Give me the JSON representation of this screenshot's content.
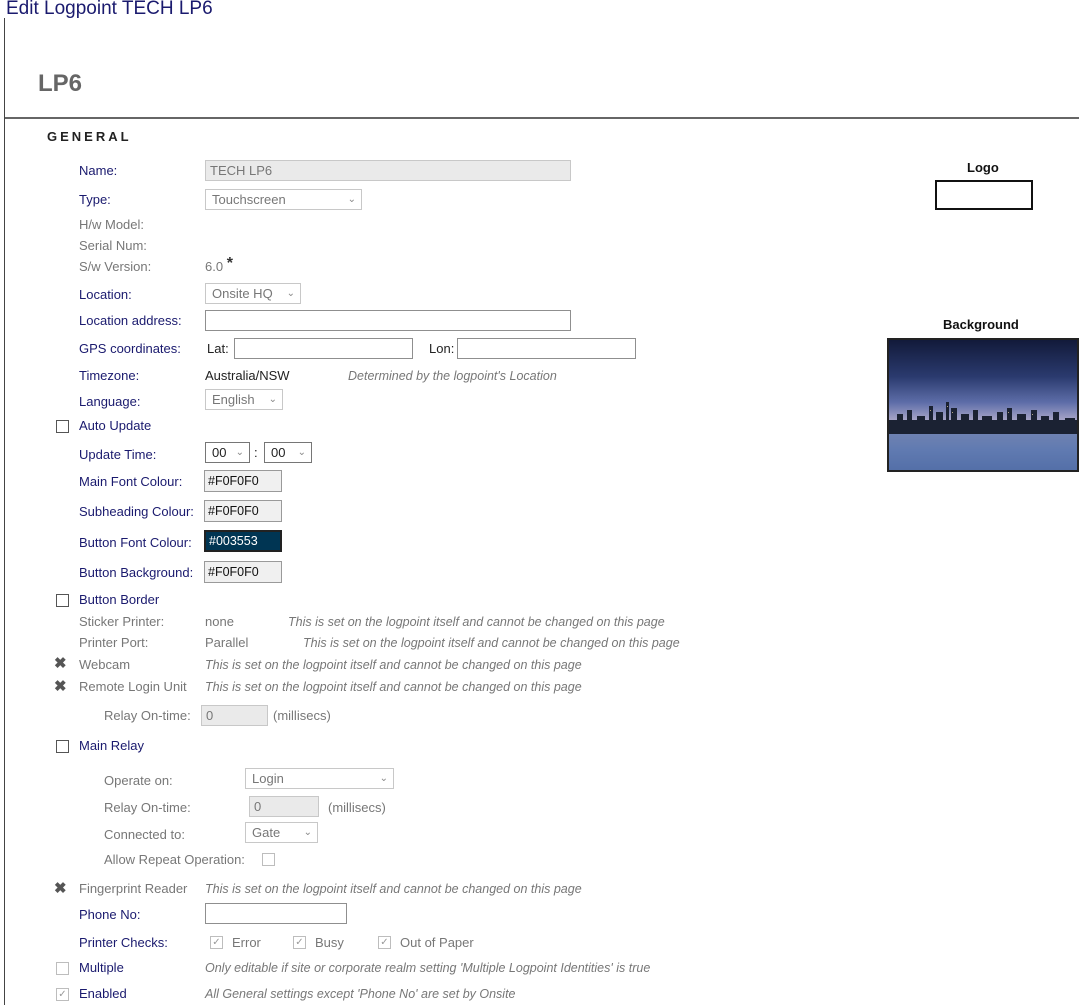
{
  "window": {
    "title": "Edit Logpoint TECH LP6"
  },
  "page": {
    "heading": "LP6",
    "section_title": "GENERAL"
  },
  "form": {
    "name": {
      "label": "Name:",
      "value": "TECH LP6"
    },
    "type": {
      "label": "Type:",
      "value": "Touchscreen"
    },
    "hw_model": {
      "label": "H/w Model:"
    },
    "serial_num": {
      "label": "Serial Num:"
    },
    "sw_version": {
      "label": "S/w Version:",
      "value": "6.0",
      "marker": "*"
    },
    "location": {
      "label": "Location:",
      "value": "Onsite HQ"
    },
    "location_address": {
      "label": "Location address:",
      "value": ""
    },
    "gps": {
      "label": "GPS coordinates:",
      "lat_label": "Lat:",
      "lat_value": "",
      "lon_label": "Lon:",
      "lon_value": ""
    },
    "timezone": {
      "label": "Timezone:",
      "value": "Australia/NSW",
      "note": "Determined by the logpoint's Location"
    },
    "language": {
      "label": "Language:",
      "value": "English"
    },
    "auto_update": {
      "label": "Auto Update",
      "checked": false
    },
    "update_time": {
      "label": "Update Time:",
      "hour": "00",
      "minute": "00",
      "separator": ":"
    },
    "main_font_colour": {
      "label": "Main Font Colour:",
      "value": "#F0F0F0"
    },
    "subheading_colour": {
      "label": "Subheading Colour:",
      "value": "#F0F0F0"
    },
    "button_font_colour": {
      "label": "Button Font Colour:",
      "value": "#003553"
    },
    "button_background": {
      "label": "Button Background:",
      "value": "#F0F0F0"
    },
    "button_border": {
      "label": "Button Border",
      "checked": false
    },
    "sticker_printer": {
      "label": "Sticker Printer:",
      "value": "none",
      "note": "This is set on the logpoint itself and cannot be changed on this page"
    },
    "printer_port": {
      "label": "Printer Port:",
      "value": "Parallel",
      "note": "This is set on the logpoint itself and cannot be changed on this page"
    },
    "webcam": {
      "label": "Webcam",
      "icon": "x-icon",
      "note": "This is set on the logpoint itself and cannot be changed on this page"
    },
    "remote_login_unit": {
      "label": "Remote Login Unit",
      "icon": "x-icon",
      "note": "This is set on the logpoint itself and cannot be changed on this page"
    },
    "relay_on_time_1": {
      "label": "Relay On-time:",
      "value": "0",
      "unit": "(millisecs)"
    },
    "main_relay": {
      "label": "Main Relay",
      "checked": false
    },
    "operate_on": {
      "label": "Operate on:",
      "value": "Login"
    },
    "relay_on_time_2": {
      "label": "Relay On-time:",
      "value": "0",
      "unit": "(millisecs)"
    },
    "connected_to": {
      "label": "Connected to:",
      "value": "Gate"
    },
    "allow_repeat": {
      "label": "Allow Repeat Operation:",
      "checked": false
    },
    "fingerprint_reader": {
      "label": "Fingerprint Reader",
      "icon": "x-icon",
      "note": "This is set on the logpoint itself and cannot be changed on this page"
    },
    "phone_no": {
      "label": "Phone No:",
      "value": ""
    },
    "printer_checks": {
      "label": "Printer Checks:",
      "error": "Error",
      "busy": "Busy",
      "out_of_paper": "Out of Paper"
    },
    "multiple": {
      "label": "Multiple",
      "checked": false,
      "note": "Only editable if site or corporate realm setting 'Multiple Logpoint Identities' is true"
    },
    "enabled": {
      "label": "Enabled",
      "checked": true,
      "note": "All General settings except 'Phone No' are set by Onsite"
    }
  },
  "sidebar": {
    "logo_label": "Logo",
    "background_label": "Background"
  },
  "colors": {
    "selected_swatch": "#003553",
    "text_blue": "#1a1a6e"
  }
}
